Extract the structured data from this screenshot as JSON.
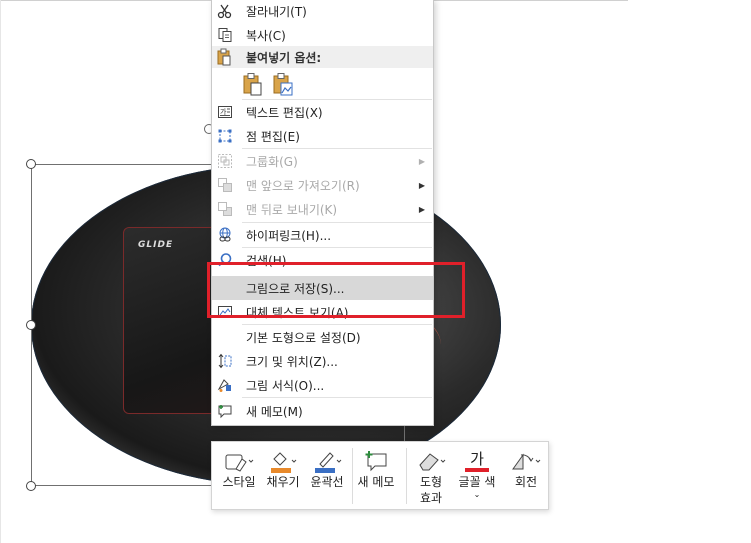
{
  "context_menu": {
    "items": [
      {
        "label": "잘라내기(T)",
        "icon": "scissors-icon",
        "disabled": false
      },
      {
        "label": "복사(C)",
        "icon": "copy-icon",
        "disabled": false
      },
      {
        "label": "붙여넣기 옵션:",
        "icon": "paste-icon",
        "disabled": false
      },
      {
        "label": "텍스트 편집(X)",
        "icon": "text-edit-icon",
        "disabled": false
      },
      {
        "label": "점 편집(E)",
        "icon": "edit-points-icon",
        "disabled": false
      },
      {
        "label": "그룹화(G)",
        "icon": "group-icon",
        "disabled": true
      },
      {
        "label": "맨 앞으로 가져오기(R)",
        "icon": "bring-front-icon",
        "disabled": true
      },
      {
        "label": "맨 뒤로 보내기(K)",
        "icon": "send-back-icon",
        "disabled": true
      },
      {
        "label": "하이퍼링크(H)...",
        "icon": "hyperlink-icon",
        "disabled": false
      },
      {
        "label": "검색(H)",
        "icon": "search-icon",
        "disabled": false
      },
      {
        "label": "그림으로 저장(S)...",
        "icon": "",
        "disabled": false
      },
      {
        "label": "대체 텍스트 보기(A)",
        "icon": "alt-text-icon",
        "disabled": false
      },
      {
        "label": "기본 도형으로 설정(D)",
        "icon": "",
        "disabled": false
      },
      {
        "label": "크기 및 위치(Z)...",
        "icon": "size-position-icon",
        "disabled": false
      },
      {
        "label": "그림 서식(O)...",
        "icon": "format-picture-icon",
        "disabled": false
      },
      {
        "label": "새 메모(M)",
        "icon": "new-comment-icon",
        "disabled": false
      }
    ]
  },
  "image": {
    "logo_text": "GLIDE"
  },
  "mini_toolbar": {
    "style": "스타일",
    "fill": "채우기",
    "outline": "윤곽선",
    "new_memo": "새 메모",
    "shape_effects_line1": "도형",
    "shape_effects_line2": "효과",
    "font_color": "글꼴 색",
    "font_color_glyph": "가",
    "rotate": "회전"
  },
  "colors": {
    "highlight": "#e0202a",
    "hover": "#d8d8d8",
    "fill_accent": "#e8892a",
    "outline_accent": "#3a6fc4",
    "font_color_bar": "#e0202a",
    "memo_plus": "#2e8b3e"
  }
}
